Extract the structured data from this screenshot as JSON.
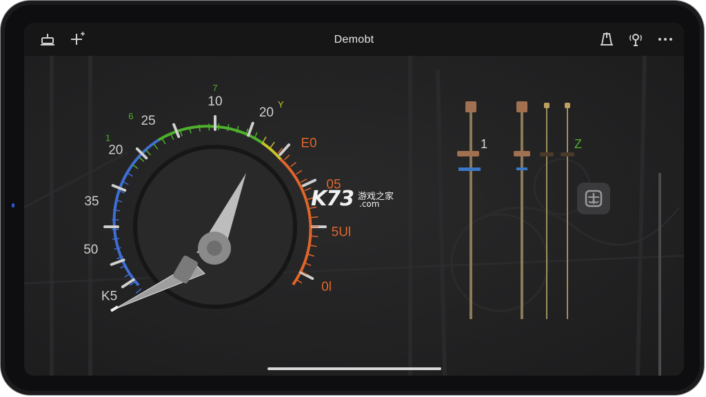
{
  "app": {
    "title": "Demobt"
  },
  "toolbar": {
    "left_icons": [
      "tuning-fork-icon",
      "add-sparkle-icon"
    ],
    "right_icons": [
      "metronome-icon",
      "microphone-icon",
      "more-icon"
    ]
  },
  "gauge": {
    "outer_labels": [
      "K5",
      "50",
      "35",
      "20",
      "25",
      "10",
      "20",
      "E0",
      "05",
      "5Ul",
      "0l"
    ],
    "inner_marks": [
      "1",
      "6",
      "7",
      "Y"
    ],
    "colors": {
      "blue": "#3f6fd6",
      "green": "#4fb02d",
      "yellow": "#c9c62a",
      "orange": "#e0662a",
      "needle": "#bdbdbd"
    }
  },
  "tuners": {
    "labels": [
      "1",
      "Z"
    ],
    "marker_color": "#3b78c8"
  },
  "side_button": {
    "icon": "chord-icon"
  },
  "watermark": {
    "brand": "K73",
    "cn_text": "游戏之家",
    "domain": ".com"
  }
}
